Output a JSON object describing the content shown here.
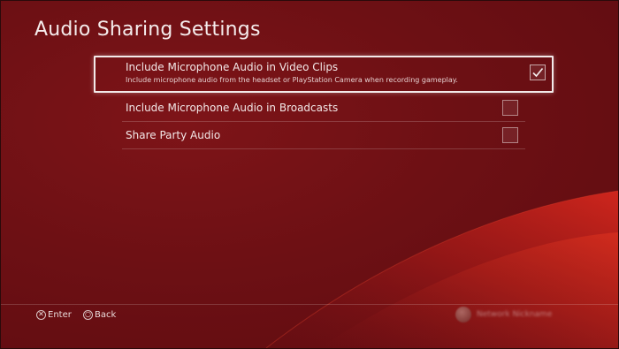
{
  "page": {
    "title": "Audio Sharing Settings"
  },
  "settings": [
    {
      "label": "Include Microphone Audio in Video Clips",
      "description": "Include microphone audio from the headset or PlayStation Camera when recording gameplay.",
      "checked": true
    },
    {
      "label": "Include Microphone Audio in Broadcasts",
      "checked": false
    },
    {
      "label": "Share Party Audio",
      "checked": false
    }
  ],
  "footer": {
    "enter": {
      "glyph": "✕",
      "label": "Enter"
    },
    "back": {
      "glyph": "○",
      "label": "Back"
    }
  },
  "user": {
    "name": "Network Nickname"
  },
  "icons": {
    "checkmark": "checkmark-icon",
    "cross_button": "cross-button-icon",
    "circle_button": "circle-button-icon",
    "avatar": "user-avatar"
  },
  "colors": {
    "background": "#6d1014",
    "swoosh": "#c0201a",
    "text": "#f2e6e6",
    "focus_border": "#f3eaea"
  }
}
